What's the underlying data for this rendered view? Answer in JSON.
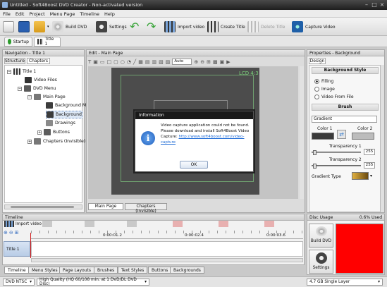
{
  "window": {
    "title": "Untitled - Soft4Boost DVD Creator - Non-activated version"
  },
  "menu": [
    "File",
    "Edit",
    "Project",
    "Menu Page",
    "Timeline",
    "Help"
  ],
  "toolbar": {
    "build_dvd": "Build DVD",
    "settings": "Settings",
    "import_video": "Import video",
    "create_title": "Create Title",
    "delete_title": "Delete Title",
    "capture_video": "Capture Video"
  },
  "tabs": {
    "startup": "Startup",
    "title1": "Title 1"
  },
  "nav": {
    "header": "Navigation - Title 1",
    "tab_structure": "Structure",
    "tab_chapters": "Chapters",
    "tree": {
      "title1": "Title 1",
      "video_files": "Video Files",
      "dvd_menu": "DVD Menu",
      "main_page": "Main Page",
      "background_m": "Background M",
      "background": "Background",
      "drawings": "Drawings",
      "buttons": "Buttons",
      "chapters": "Chapters (Invisible)"
    }
  },
  "edit": {
    "header": "Edit - Main Page",
    "zoom": "Auto",
    "lcd": "LCD 4:3",
    "tab_main": "Main Page",
    "tab_chapters": "Chapters (Invisible)"
  },
  "dialog": {
    "title": "Information",
    "line1": "Video capture application could not be found.",
    "line2": "Please download and install Soft4Boost Video",
    "line3": "Capture:",
    "link": "http://www.soft4boost.com/video-",
    "link2": "capture",
    "ok": "OK"
  },
  "props": {
    "header": "Properties - Background",
    "tab": "Design",
    "bg_style": "Background Style",
    "filling": "Filling",
    "image": "Image",
    "video_from_file": "Video From File",
    "brush": "Brush",
    "brush_type": "Gradient",
    "color1": "Color 1",
    "color2": "Color 2",
    "transparency1": "Transparency 1",
    "t1_val": "255",
    "transparency2": "Transparency 2",
    "t2_val": "255",
    "gradient_type": "Gradient Type"
  },
  "timeline": {
    "header": "Timeline",
    "import": "Import video",
    "times": [
      "0:00:01.2",
      "0:00:02.4",
      "0:00:03.6"
    ],
    "track": "Title 1"
  },
  "disc": {
    "header": "Disc Usage",
    "percent": "0.6% Used",
    "build": "Build DVD",
    "settings": "Settings"
  },
  "bottom_tabs": [
    "Timeline",
    "Menu Styles",
    "Page Layouts",
    "Brushes",
    "Text Styles",
    "Buttons",
    "Backgrounds"
  ],
  "status": {
    "format": "DVD NTSC",
    "quality": "High Quality (HQ 60/108 min. at 1 DVD/DL DVD Disc)",
    "disc": "4.7 GB Single Layer"
  },
  "colors": {
    "accent": "#1e6bd6",
    "disc_fill": "#ff0000"
  }
}
